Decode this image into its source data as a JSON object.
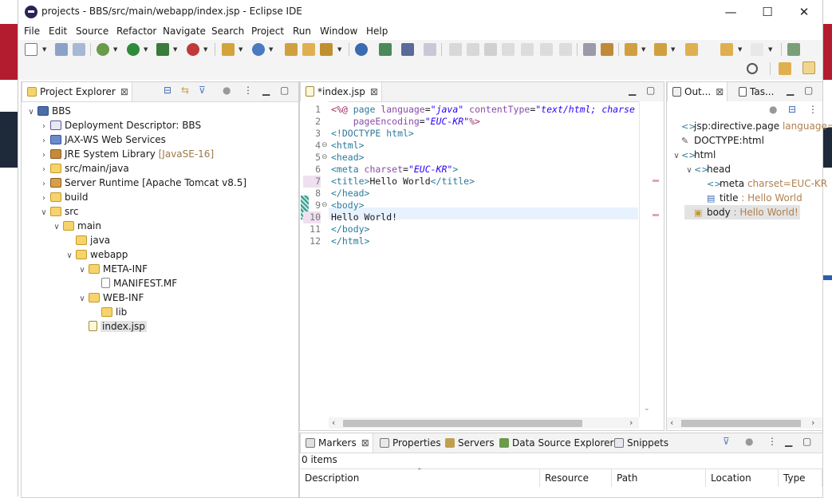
{
  "window": {
    "title": "projects - BBS/src/main/webapp/index.jsp - Eclipse IDE",
    "minimize": "—",
    "maximize": "☐",
    "close": "✕"
  },
  "menu": [
    "File",
    "Edit",
    "Source",
    "Refactor",
    "Navigate",
    "Search",
    "Project",
    "Run",
    "Window",
    "Help"
  ],
  "project_explorer": {
    "tab_label": "Project Explorer",
    "tree": [
      {
        "label": "BBS",
        "level": 0,
        "expanded": true,
        "icon": "project-icon"
      },
      {
        "label": "Deployment Descriptor: BBS",
        "level": 1,
        "icon": "deployment-descriptor-icon"
      },
      {
        "label": "JAX-WS Web Services",
        "level": 1,
        "icon": "web-services-icon"
      },
      {
        "label": "JRE System Library",
        "suffix": "[JavaSE-16]",
        "level": 1,
        "icon": "library-icon"
      },
      {
        "label": "src/main/java",
        "level": 1,
        "icon": "source-folder-icon"
      },
      {
        "label": "Server Runtime [Apache Tomcat v8.5]",
        "level": 1,
        "icon": "server-runtime-icon"
      },
      {
        "label": "build",
        "level": 1,
        "icon": "folder-icon"
      },
      {
        "label": "src",
        "level": 1,
        "expanded": true,
        "icon": "folder-icon"
      },
      {
        "label": "main",
        "level": 2,
        "expanded": true,
        "icon": "folder-icon"
      },
      {
        "label": "java",
        "level": 3,
        "icon": "folder-icon"
      },
      {
        "label": "webapp",
        "level": 3,
        "expanded": true,
        "icon": "folder-icon"
      },
      {
        "label": "META-INF",
        "level": 4,
        "expanded": true,
        "icon": "folder-icon"
      },
      {
        "label": "MANIFEST.MF",
        "level": 5,
        "icon": "file-icon"
      },
      {
        "label": "WEB-INF",
        "level": 4,
        "expanded": true,
        "icon": "folder-icon"
      },
      {
        "label": "lib",
        "level": 5,
        "icon": "folder-icon"
      },
      {
        "label": "index.jsp",
        "level": 4,
        "icon": "jsp-file-icon",
        "selected": true
      }
    ]
  },
  "editor": {
    "tab_label": "*index.jsp",
    "line_numbers": [
      "1",
      "2",
      "3",
      "4",
      "5",
      "6",
      "7",
      "8",
      "9",
      "10",
      "11",
      "12"
    ],
    "lines": [
      {
        "fold": "",
        "parts": [
          [
            "kw",
            "<%@ "
          ],
          [
            "tg",
            "page "
          ],
          [
            "at",
            "language"
          ],
          [
            "pl",
            "="
          ],
          [
            "st",
            "\"java\""
          ],
          [
            "pl",
            " "
          ],
          [
            "at",
            "contentType"
          ],
          [
            "pl",
            "="
          ],
          [
            "st",
            "\"text/html; charse"
          ]
        ]
      },
      {
        "fold": "",
        "parts": [
          [
            "pl",
            "    "
          ],
          [
            "at",
            "pageEncoding"
          ],
          [
            "pl",
            "="
          ],
          [
            "st",
            "\"EUC-KR\""
          ],
          [
            "kw",
            "%>"
          ]
        ]
      },
      {
        "fold": "",
        "parts": [
          [
            "tg",
            "<!DOCTYPE html>"
          ]
        ]
      },
      {
        "fold": "⊖",
        "parts": [
          [
            "tg",
            "<html>"
          ]
        ]
      },
      {
        "fold": "⊖",
        "parts": [
          [
            "tg",
            "<head>"
          ]
        ]
      },
      {
        "fold": "",
        "parts": [
          [
            "tg",
            "<meta "
          ],
          [
            "at",
            "charset"
          ],
          [
            "pl",
            "="
          ],
          [
            "st",
            "\"EUC-KR\""
          ],
          [
            "tg",
            ">"
          ]
        ]
      },
      {
        "fold": "",
        "parts": [
          [
            "tg",
            "<title>"
          ],
          [
            "pl",
            "Hello World"
          ],
          [
            "tg",
            "</title>"
          ]
        ]
      },
      {
        "fold": "",
        "parts": [
          [
            "tg",
            "</head>"
          ]
        ]
      },
      {
        "fold": "⊖",
        "parts": [
          [
            "tg",
            "<body>"
          ]
        ]
      },
      {
        "fold": "",
        "parts": [
          [
            "pl",
            "Hello World!"
          ]
        ]
      },
      {
        "fold": "",
        "parts": [
          [
            "tg",
            "</body>"
          ]
        ]
      },
      {
        "fold": "",
        "parts": [
          [
            "tg",
            "</html>"
          ]
        ]
      }
    ]
  },
  "outline": {
    "tab_label": "Out...",
    "tab2_label": "Tas...",
    "rows": [
      {
        "label": "jsp:directive.page",
        "attr": "language=",
        "level": 0,
        "twisty": "",
        "icon": "directive-icon"
      },
      {
        "label": "DOCTYPE:html",
        "attr": "",
        "level": 0,
        "twisty": "",
        "icon": "doctype-icon"
      },
      {
        "label": "html",
        "attr": "",
        "level": 0,
        "twisty": "∨",
        "icon": "element-icon"
      },
      {
        "label": "head",
        "attr": "",
        "level": 1,
        "twisty": "∨",
        "icon": "element-icon"
      },
      {
        "label": "meta",
        "attr": "charset=EUC-KR",
        "level": 2,
        "twisty": "",
        "icon": "element-icon"
      },
      {
        "label": "title",
        "attr": ": Hello World",
        "level": 2,
        "twisty": "",
        "icon": "title-icon"
      },
      {
        "label": "body",
        "attr": ": Hello World!",
        "level": 1,
        "twisty": "",
        "icon": "body-icon",
        "selected": true
      }
    ]
  },
  "bottom": {
    "tabs": [
      "Markers",
      "Properties",
      "Servers",
      "Data Source Explorer",
      "Snippets"
    ],
    "status": "0 items",
    "columns": [
      "Description",
      "Resource",
      "Path",
      "Location",
      "Type"
    ]
  }
}
